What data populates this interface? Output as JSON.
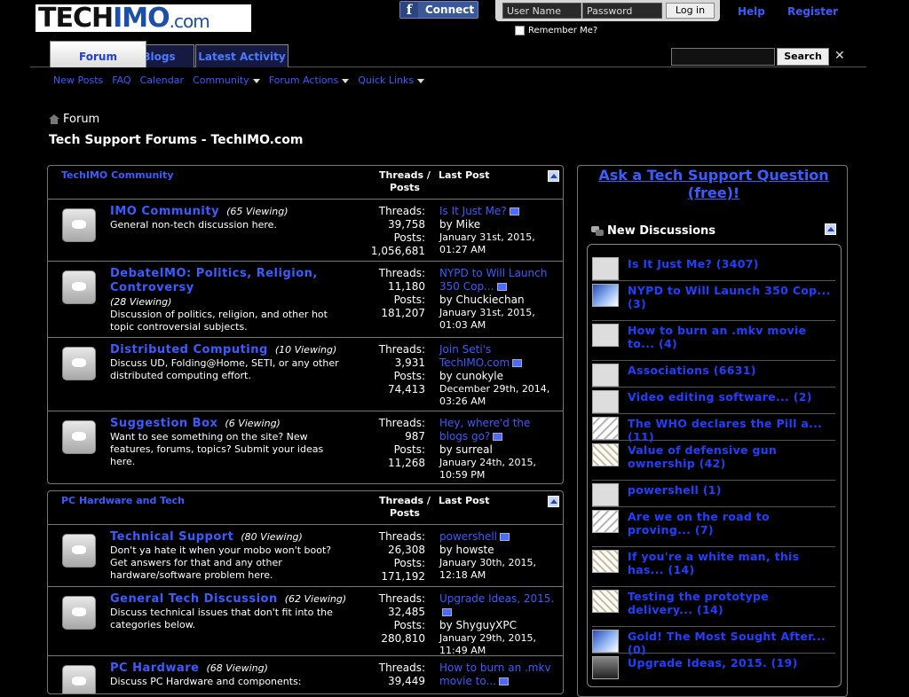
{
  "header": {
    "logo_text_1": "TECH",
    "logo_text_2": "IMO",
    "logo_text_3": ".com",
    "fb_connect": "Connect",
    "username_placeholder": "User Name",
    "password_placeholder": "Password",
    "login_button": "Log in",
    "remember_me": "Remember Me?",
    "help": "Help",
    "register": "Register"
  },
  "tabs": [
    {
      "label": "Forum"
    },
    {
      "label": "Blogs"
    },
    {
      "label": "Latest Activity"
    }
  ],
  "search": {
    "button": "Search",
    "close": "✕"
  },
  "subnav": [
    "New Posts",
    "FAQ",
    "Calendar",
    "Community",
    "Forum Actions",
    "Quick Links"
  ],
  "breadcrumb": "Forum",
  "page_title": "Tech Support Forums - TechIMO.com",
  "sections": [
    {
      "name": "TechIMO Community",
      "threads_posts_header": "Threads / Posts",
      "last_post_header": "Last Post",
      "forums": [
        {
          "title": "IMO Community",
          "viewing": "(65 Viewing)",
          "desc": "General non-tech discussion here.",
          "threads": "39,758",
          "posts": "1,056,681",
          "last_title": "Is It Just Me?",
          "last_by": "by Mike",
          "last_date": "January 31st, 2015, 01:27 AM"
        },
        {
          "title": "DebateIMO: Politics, Religion, Controversy",
          "viewing": "(28 Viewing)",
          "desc": "Discussion of politics, religion, and other hot topic controversial subjects.",
          "threads": "11,180",
          "posts": "181,207",
          "last_title": "NYPD to Will Launch 350 Cop...",
          "last_by": "by Chuckiechan",
          "last_date": "January 31st, 2015, 01:03 AM"
        },
        {
          "title": "Distributed Computing",
          "viewing": "(10 Viewing)",
          "desc": "Discuss UD, Folding@Home, SETI, or any other distributed computing effort.",
          "threads": "3,931",
          "posts": "74,413",
          "last_title": "Join Seti's TechIMO.com",
          "last_by": "by cunokyle",
          "last_date": "December 29th, 2014, 03:26 AM"
        },
        {
          "title": "Suggestion Box",
          "viewing": "(6 Viewing)",
          "desc": "Want to see something on the site? New features, forums, topics? Submit your ideas here.",
          "threads": "987",
          "posts": "11,268",
          "last_title": "Hey, where'd the blogs go?",
          "last_by": "by surreal",
          "last_date": "January 24th, 2015, 10:59 PM"
        }
      ]
    },
    {
      "name": "PC Hardware and Tech",
      "threads_posts_header": "Threads / Posts",
      "last_post_header": "Last Post",
      "forums": [
        {
          "title": "Technical Support",
          "viewing": "(80 Viewing)",
          "desc": "Don't ya hate it when your mobo won't boot? Get answers for that and any other hardware/software problem here.",
          "threads": "26,308",
          "posts": "171,192",
          "last_title": "powershell",
          "last_by": "by howste",
          "last_date": "January 30th, 2015, 12:18 AM"
        },
        {
          "title": "General Tech Discussion",
          "viewing": "(62 Viewing)",
          "desc": "Discuss technical issues that don't fit into the categories below.",
          "threads": "32,485",
          "posts": "280,810",
          "last_title": "Upgrade Ideas, 2015.",
          "last_by": "by ShyguyXPC",
          "last_date": "January 29th, 2015, 11:49 AM"
        },
        {
          "title": "PC Hardware",
          "viewing": "(68 Viewing)",
          "desc": "Discuss PC Hardware and components:",
          "threads": "39,449",
          "posts": "",
          "last_title": "How to burn an .mkv movie to...",
          "last_by": "",
          "last_date": ""
        }
      ]
    }
  ],
  "labels": {
    "threads": "Threads:",
    "posts": "Posts:"
  },
  "sidebar": {
    "ask": "Ask a Tech Support Question (free)!",
    "new_discussions": "New Discussions",
    "discussions": [
      "Is It Just Me? (3407)",
      "NYPD to Will Launch 350 Cop... (3)",
      "How to burn an .mkv movie to... (4)",
      "Associations (6631)",
      "Video editing software... (2)",
      "The WHO declares the Pill a... (11)",
      "Value of defensive gun ownership (42)",
      "powershell (1)",
      "Are we on the road to proving... (7)",
      "If you're a white man, this has... (14)",
      "Testing the prototype delivery... (14)",
      "Gold! The Most Sought After... (0)",
      "Upgrade Ideas, 2015. (19)"
    ]
  }
}
